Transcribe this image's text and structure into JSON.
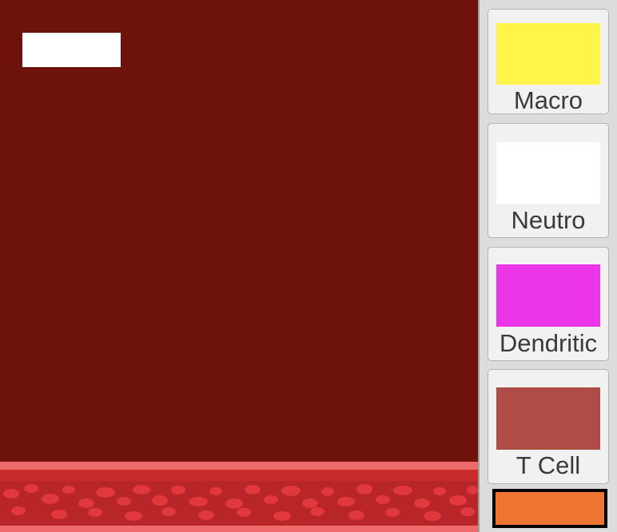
{
  "scene": {
    "tissue_color": "#6e120c",
    "score_box_color": "#ffffff",
    "vessel": {
      "wall_light": "#ef6a6a",
      "wall_mid": "#c92b2b",
      "lumen": "#b9262a",
      "cell_color": "#e0383c"
    }
  },
  "panel": {
    "background": "#dcdcdc",
    "cards": [
      {
        "id": "macro",
        "label": "Macro",
        "swatch_color": "#fff44a"
      },
      {
        "id": "neutro",
        "label": "Neutro",
        "swatch_color": "#ffffff"
      },
      {
        "id": "dendritic",
        "label": "Dendritic",
        "swatch_color": "#ec35e9"
      },
      {
        "id": "tcell",
        "label": "T Cell",
        "swatch_color": "#b04c48"
      }
    ],
    "selected_slot": {
      "color": "#ef7632"
    }
  }
}
